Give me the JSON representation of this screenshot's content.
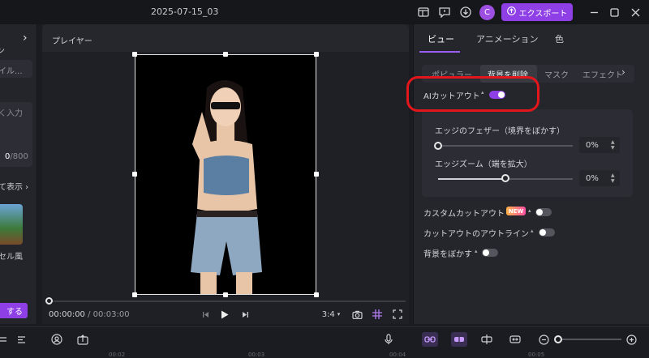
{
  "titlebar": {
    "project_title": "2025-07-15_03",
    "avatar_letter": "C",
    "export_label": "エクスポート"
  },
  "left_panel": {
    "partial_label_1": "ン",
    "partial_field_1": "イル...",
    "partial_textarea": "く入力",
    "char_count_current": "0",
    "char_count_max": "/800",
    "show_more": "て表示",
    "thumb_label": "セル風",
    "action_button": "する"
  },
  "player": {
    "title": "プレイヤー",
    "time_current": "00:00:00",
    "time_total": "/ 00:03:00",
    "aspect": "3:4"
  },
  "right_panel": {
    "tabs": [
      "ビュー",
      "アニメーション",
      "色"
    ],
    "subtabs": [
      "ポピュラー",
      "背景を削除",
      "マスク",
      "エフェクト"
    ],
    "ai_cutout_label": "AIカットアウト",
    "ai_cutout_on": true,
    "edge_feather_label": "エッジのフェザー（境界をぼかす）",
    "edge_feather_value": "0%",
    "edge_feather_fraction": 0,
    "edge_zoom_label": "エッジズーム（端を拡大）",
    "edge_zoom_value": "0%",
    "edge_zoom_fraction": 0.5,
    "custom_cutout_label": "カスタムカットアウト",
    "new_badge": "NEW",
    "cutout_outline_label": "カットアウトのアウトライン",
    "blur_bg_label": "背景をぼかす"
  },
  "colors": {
    "accent": "#8e3fe6",
    "annotation_red": "#e3161b"
  },
  "timeline_ruler": [
    "00:02",
    "00:03",
    "00:04",
    "00:05"
  ]
}
